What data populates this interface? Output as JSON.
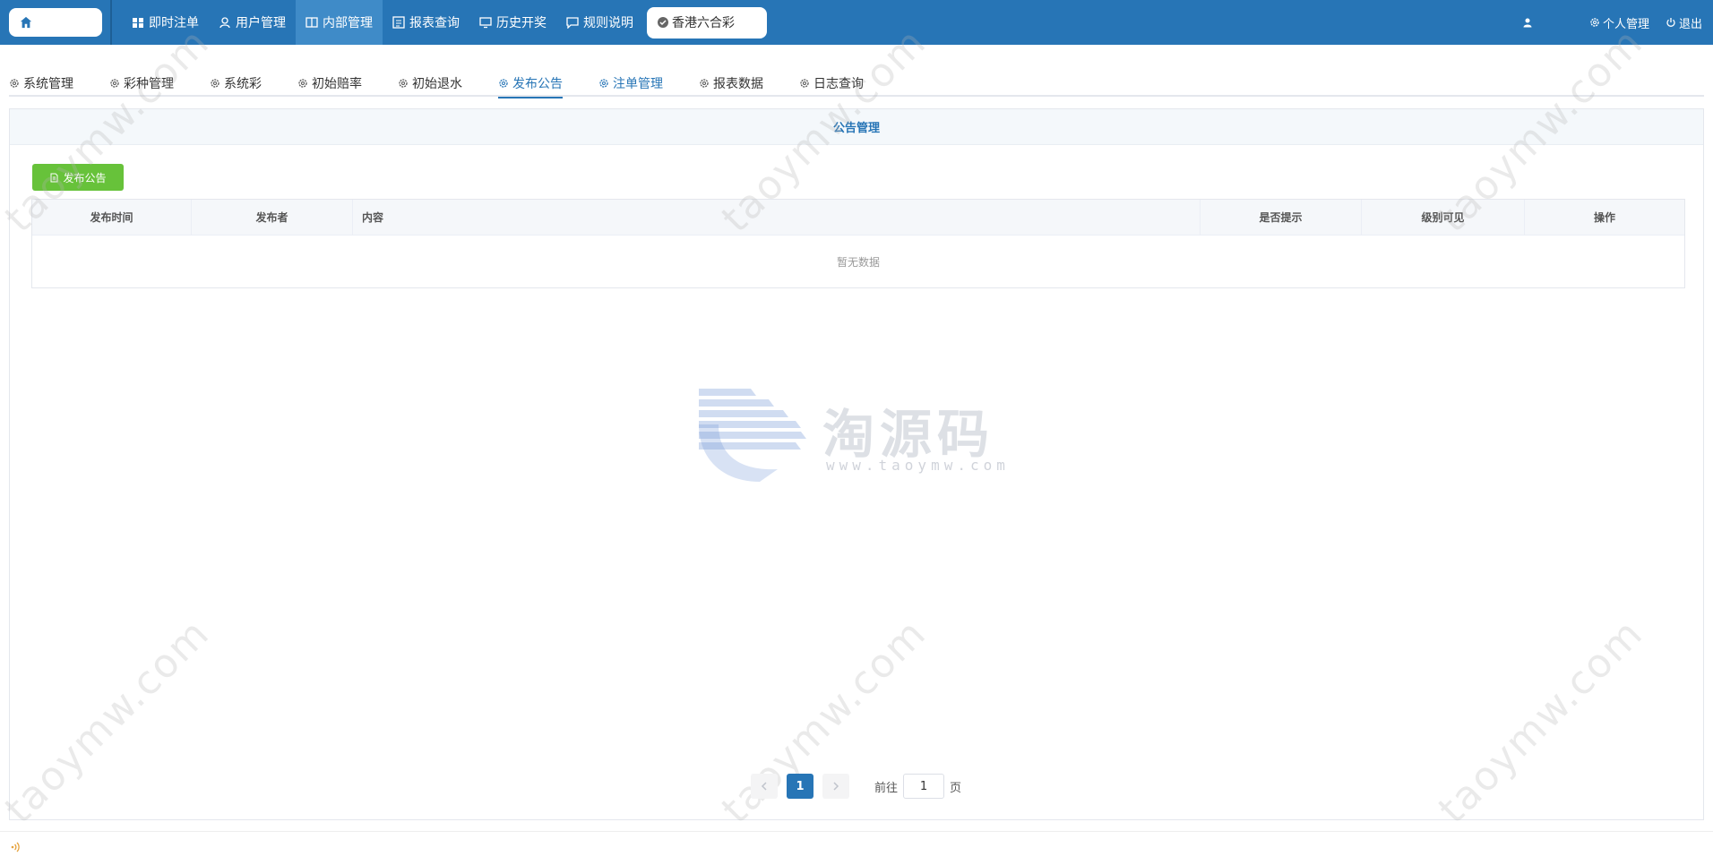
{
  "topnav": {
    "items": [
      {
        "label": "即时注单",
        "icon": "grid-icon",
        "active": false
      },
      {
        "label": "用户管理",
        "icon": "user-icon",
        "active": false
      },
      {
        "label": "内部管理",
        "icon": "book-icon",
        "active": true
      },
      {
        "label": "报表查询",
        "icon": "report-icon",
        "active": false
      },
      {
        "label": "历史开奖",
        "icon": "monitor-icon",
        "active": false
      },
      {
        "label": "规则说明",
        "icon": "message-icon",
        "active": false
      }
    ],
    "lottery_selector": "香港六合彩",
    "personal": "个人管理",
    "logout": "退出"
  },
  "subtabs": [
    {
      "label": "系统管理",
      "state": "normal"
    },
    {
      "label": "彩种管理",
      "state": "normal"
    },
    {
      "label": "系统彩",
      "state": "normal"
    },
    {
      "label": "初始赔率",
      "state": "normal"
    },
    {
      "label": "初始退水",
      "state": "normal"
    },
    {
      "label": "发布公告",
      "state": "active"
    },
    {
      "label": "注单管理",
      "state": "blue"
    },
    {
      "label": "报表数据",
      "state": "normal"
    },
    {
      "label": "日志查询",
      "state": "normal"
    }
  ],
  "panel": {
    "title": "公告管理",
    "add_button": "发布公告",
    "columns": [
      "发布时间",
      "发布者",
      "内容",
      "是否提示",
      "级别可见",
      "操作"
    ],
    "empty_text": "暂无数据"
  },
  "pagination": {
    "current_page": "1",
    "goto_label": "前往",
    "goto_value": "1",
    "page_suffix": "页"
  },
  "watermark": {
    "text": "taoymw.com",
    "logo_text": "淘源码",
    "logo_url": "www.taoymw.com"
  },
  "colors": {
    "primary": "#2775b6",
    "success": "#67c23a"
  }
}
